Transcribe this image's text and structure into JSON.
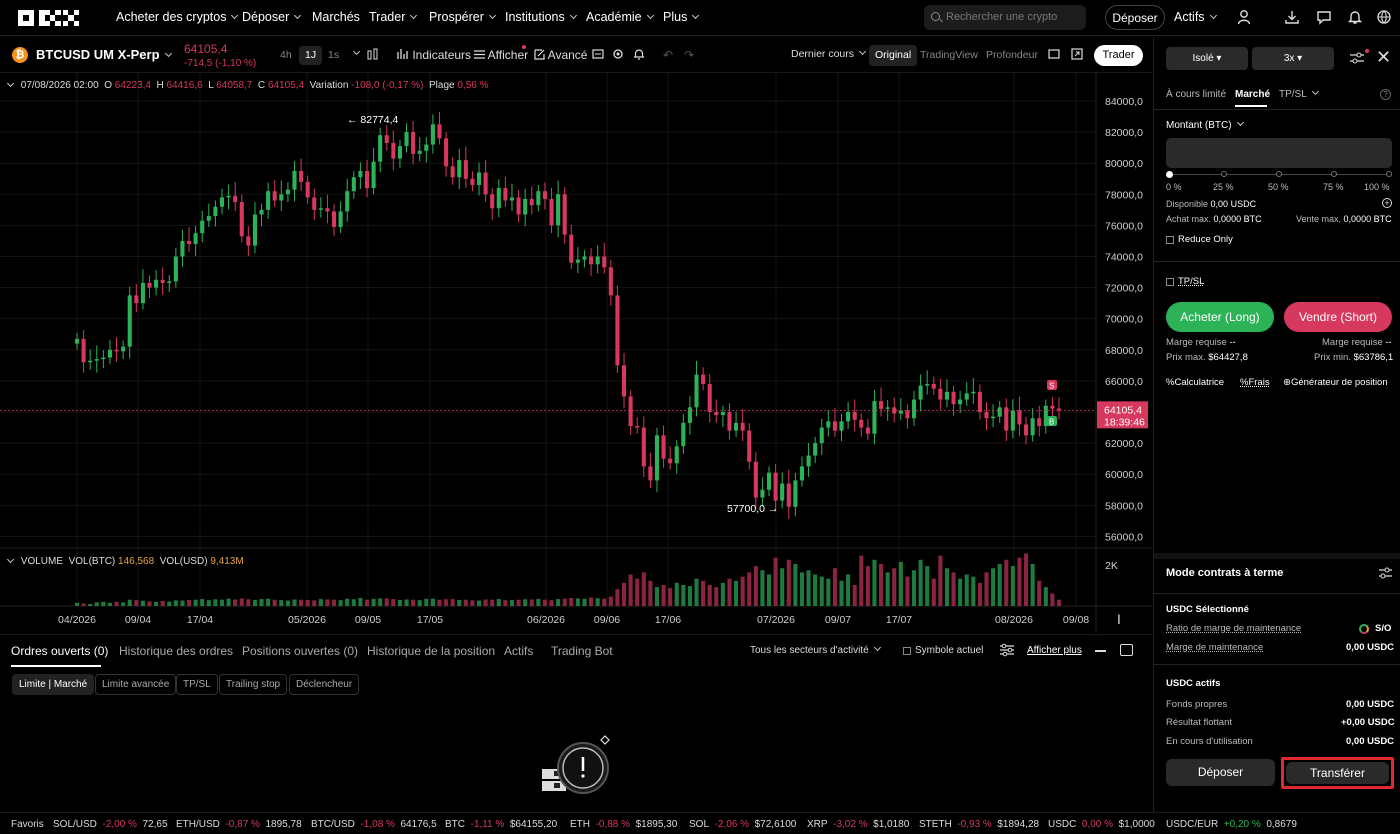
{
  "nav": {
    "logo": "OKX",
    "items": [
      "Acheter des cryptos",
      "Déposer",
      "Marchés",
      "Trader",
      "Prospérer",
      "Institutions",
      "Académie",
      "Plus"
    ],
    "search_placeholder": "Rechercher une crypto",
    "deposit": "Déposer",
    "assets": "Actifs"
  },
  "toolbar": {
    "symbol": "BTCUSD UM X-Perp",
    "price": "64105,4",
    "change": "-714,5 (-1,10 %)",
    "intervals": [
      "4h",
      "1J",
      "1s"
    ],
    "active_interval": "1J",
    "indicators": "Indicateurs",
    "display": "Afficher",
    "advanced": "Avancé",
    "price_mode": "Dernier cours",
    "views": [
      "Original",
      "TradingView",
      "Profondeur"
    ],
    "active_view": "Original",
    "trader": "Trader"
  },
  "ohlc": {
    "date": "07/08/2026 02:00",
    "o_label": "O",
    "o": "64223,4",
    "h_label": "H",
    "h": "64416,6",
    "l_label": "L",
    "l": "64058,7",
    "c_label": "C",
    "c": "64105,4",
    "variation_label": "Variation",
    "variation": "-108,0 (-0,17 %)",
    "range_label": "Plage",
    "range": "0,56 %"
  },
  "volume": {
    "label": "VOLUME",
    "btc_label": "VOL(BTC)",
    "btc": "146,568",
    "usd_label": "VOL(USD)",
    "usd": "9,413M",
    "axis": "2K"
  },
  "chart_data": {
    "type": "candlestick",
    "y_ticks": [
      "84000,0",
      "82000,0",
      "80000,0",
      "78000,0",
      "76000,0",
      "74000,0",
      "72000,0",
      "70000,0",
      "68000,0",
      "66000,0",
      "64000,0",
      "62000,0",
      "60000,0",
      "58000,0",
      "56000,0"
    ],
    "x_ticks": [
      "04/2026",
      "09/04",
      "17/04",
      "05/2026",
      "09/05",
      "17/05",
      "06/2026",
      "09/06",
      "17/06",
      "07/2026",
      "09/07",
      "17/07",
      "08/2026",
      "09/08"
    ],
    "ylim": [
      55000,
      85000
    ],
    "high_marker": "← 82774,4",
    "low_marker": "57700,0 →",
    "last_price": "64105,4",
    "countdown": "18:39:46",
    "close": [
      68700,
      67200,
      67300,
      67400,
      67500,
      68000,
      67900,
      68200,
      71500,
      71000,
      72300,
      72000,
      72500,
      72300,
      72400,
      74000,
      75000,
      74800,
      75500,
      76300,
      76600,
      77200,
      77800,
      77900,
      77500,
      75300,
      74700,
      76700,
      77000,
      78200,
      77600,
      78000,
      78300,
      79500,
      78800,
      77800,
      77000,
      77100,
      76900,
      75900,
      76900,
      78200,
      79100,
      79500,
      78400,
      80100,
      81800,
      81300,
      80300,
      81100,
      82000,
      80600,
      80800,
      81200,
      82500,
      81600,
      79800,
      79100,
      80200,
      79000,
      78600,
      79400,
      78000,
      77100,
      78400,
      77600,
      77800,
      76700,
      77700,
      77300,
      78200,
      77700,
      76000,
      78000,
      75400,
      73600,
      73800,
      74000,
      73500,
      74000,
      73300,
      71500,
      67000,
      65000,
      63100,
      63000,
      60500,
      59600,
      62500,
      61000,
      60700,
      61800,
      63300,
      64300,
      66400,
      65800,
      64000,
      63800,
      64000,
      62800,
      63300,
      62800,
      60800,
      58500,
      59000,
      60100,
      58300,
      59400,
      57900,
      59600,
      60500,
      61200,
      62000,
      63000,
      63400,
      62800,
      63400,
      64000,
      63500,
      63000,
      62600,
      64700,
      64200,
      64300,
      63900,
      64100,
      63600,
      64800,
      65700,
      65800,
      65500,
      64800,
      65300,
      64500,
      64800,
      65200,
      65300,
      64000,
      63600,
      63700,
      64300,
      62800,
      64100,
      63200,
      62500,
      63600,
      63100,
      64400,
      64224,
      64105
    ],
    "volume": [
      0.15,
      0.12,
      0.1,
      0.18,
      0.2,
      0.15,
      0.2,
      0.17,
      0.3,
      0.28,
      0.25,
      0.22,
      0.2,
      0.24,
      0.21,
      0.27,
      0.26,
      0.29,
      0.3,
      0.33,
      0.28,
      0.32,
      0.3,
      0.35,
      0.31,
      0.36,
      0.32,
      0.29,
      0.33,
      0.35,
      0.3,
      0.28,
      0.26,
      0.31,
      0.3,
      0.29,
      0.27,
      0.33,
      0.31,
      0.3,
      0.28,
      0.35,
      0.32,
      0.38,
      0.3,
      0.34,
      0.36,
      0.37,
      0.33,
      0.29,
      0.31,
      0.3,
      0.28,
      0.34,
      0.35,
      0.3,
      0.32,
      0.33,
      0.29,
      0.3,
      0.27,
      0.26,
      0.31,
      0.3,
      0.33,
      0.28,
      0.29,
      0.3,
      0.32,
      0.31,
      0.34,
      0.3,
      0.28,
      0.33,
      0.35,
      0.38,
      0.36,
      0.34,
      0.4,
      0.37,
      0.35,
      0.45,
      0.8,
      1.1,
      1.5,
      1.3,
      1.6,
      1.2,
      0.9,
      1.0,
      0.85,
      1.1,
      1.0,
      0.95,
      1.3,
      1.2,
      1.0,
      0.9,
      1.1,
      1.3,
      1.2,
      1.4,
      1.6,
      1.9,
      1.7,
      1.5,
      2.3,
      1.8,
      2.2,
      2.0,
      1.6,
      1.7,
      1.5,
      1.4,
      1.3,
      1.8,
      1.2,
      1.5,
      1.0,
      2.4,
      1.9,
      2.2,
      2.0,
      1.6,
      1.8,
      2.1,
      1.4,
      1.7,
      2.2,
      1.9,
      1.3,
      2.4,
      1.8,
      1.6,
      1.3,
      1.5,
      1.4,
      1.1,
      1.6,
      1.8,
      2.0,
      2.2,
      1.9,
      2.3,
      2.5,
      2.0,
      1.2,
      0.9,
      0.6,
      0.3
    ]
  },
  "bottom": {
    "tabs": [
      "Ordres ouverts (0)",
      "Historique des ordres",
      "Positions ouvertes (0)",
      "Historique de la position",
      "Actifs",
      "Trading Bot"
    ],
    "sectors": "Tous les secteurs d'activité",
    "current_symbol": "Symbole actuel",
    "show_more": "Afficher plus",
    "chips": [
      "Limite | Marché",
      "Limite avancée",
      "TP/SL",
      "Trailing stop",
      "Déclencheur"
    ]
  },
  "ticker": {
    "favorites": "Favoris",
    "items": [
      {
        "sym": "SOL/USD",
        "chg": "-2,00 %",
        "price": "72,65"
      },
      {
        "sym": "ETH/USD",
        "chg": "-0,87 %",
        "price": "1895,78"
      },
      {
        "sym": "BTC/USD",
        "chg": "-1,08 %",
        "price": "64176,5"
      },
      {
        "sym": "BTC",
        "chg": "-1,11 %",
        "price": "$64155,20"
      },
      {
        "sym": "ETH",
        "chg": "-0,88 %",
        "price": "$1895,30"
      },
      {
        "sym": "SOL",
        "chg": "-2,06 %",
        "price": "$72,6100"
      },
      {
        "sym": "XRP",
        "chg": "-3,02 %",
        "price": "$1,0180"
      },
      {
        "sym": "STETH",
        "chg": "-0,93 %",
        "price": "$1894,28"
      },
      {
        "sym": "USDC",
        "chg": "0,00 %",
        "price": "$1,0000"
      },
      {
        "sym": "USDC/EUR",
        "chg": "+0,20 %",
        "price": "0,8679"
      }
    ]
  },
  "panel": {
    "margin_mode": "Isolé",
    "leverage": "3x",
    "order_tabs": [
      "À cours limité",
      "Marché",
      "TP/SL"
    ],
    "active_order_tab": "Marché",
    "amount_label": "Montant (BTC)",
    "slider_labels": [
      "0 %",
      "25 %",
      "50 %",
      "75 %",
      "100 %"
    ],
    "available_label": "Disponible",
    "available": "0,00 USDC",
    "buy_max_label": "Achat max.",
    "buy_max": "0,0000 BTC",
    "sell_max_label": "Vente max.",
    "sell_max": "0,0000 BTC",
    "reduce_only": "Reduce Only",
    "tpsl": "TP/SL",
    "buy": "Acheter (Long)",
    "sell": "Vendre (Short)",
    "margin_req_label": "Marge requise",
    "margin_req": "--",
    "max_price_label": "Prix max.",
    "max_price": "$64427,8",
    "min_price_label": "Prix min.",
    "min_price": "$63786,1",
    "calculator": "Calculatrice",
    "fees": "Frais",
    "position_gen": "Générateur de position",
    "futures_mode": "Mode contrats à terme",
    "usdc_selected": "USDC Sélectionné",
    "maint_ratio_label": "Ratio de marge de maintenance",
    "maint_ratio": "S/O",
    "maint_margin_label": "Marge de maintenance",
    "maint_margin": "0,00 USDC",
    "usdc_assets": "USDC actifs",
    "equity_label": "Fonds propres",
    "equity": "0,00 USDC",
    "pnl_label": "Résultat flottant",
    "pnl": "+0,00 USDC",
    "in_use_label": "En cours d'utilisation",
    "in_use": "0,00 USDC",
    "deposit": "Déposer",
    "transfer": "Transférer"
  },
  "colors": {
    "up": "#2db357",
    "down": "#d7385e",
    "accent_red_box": "#e0282e"
  }
}
